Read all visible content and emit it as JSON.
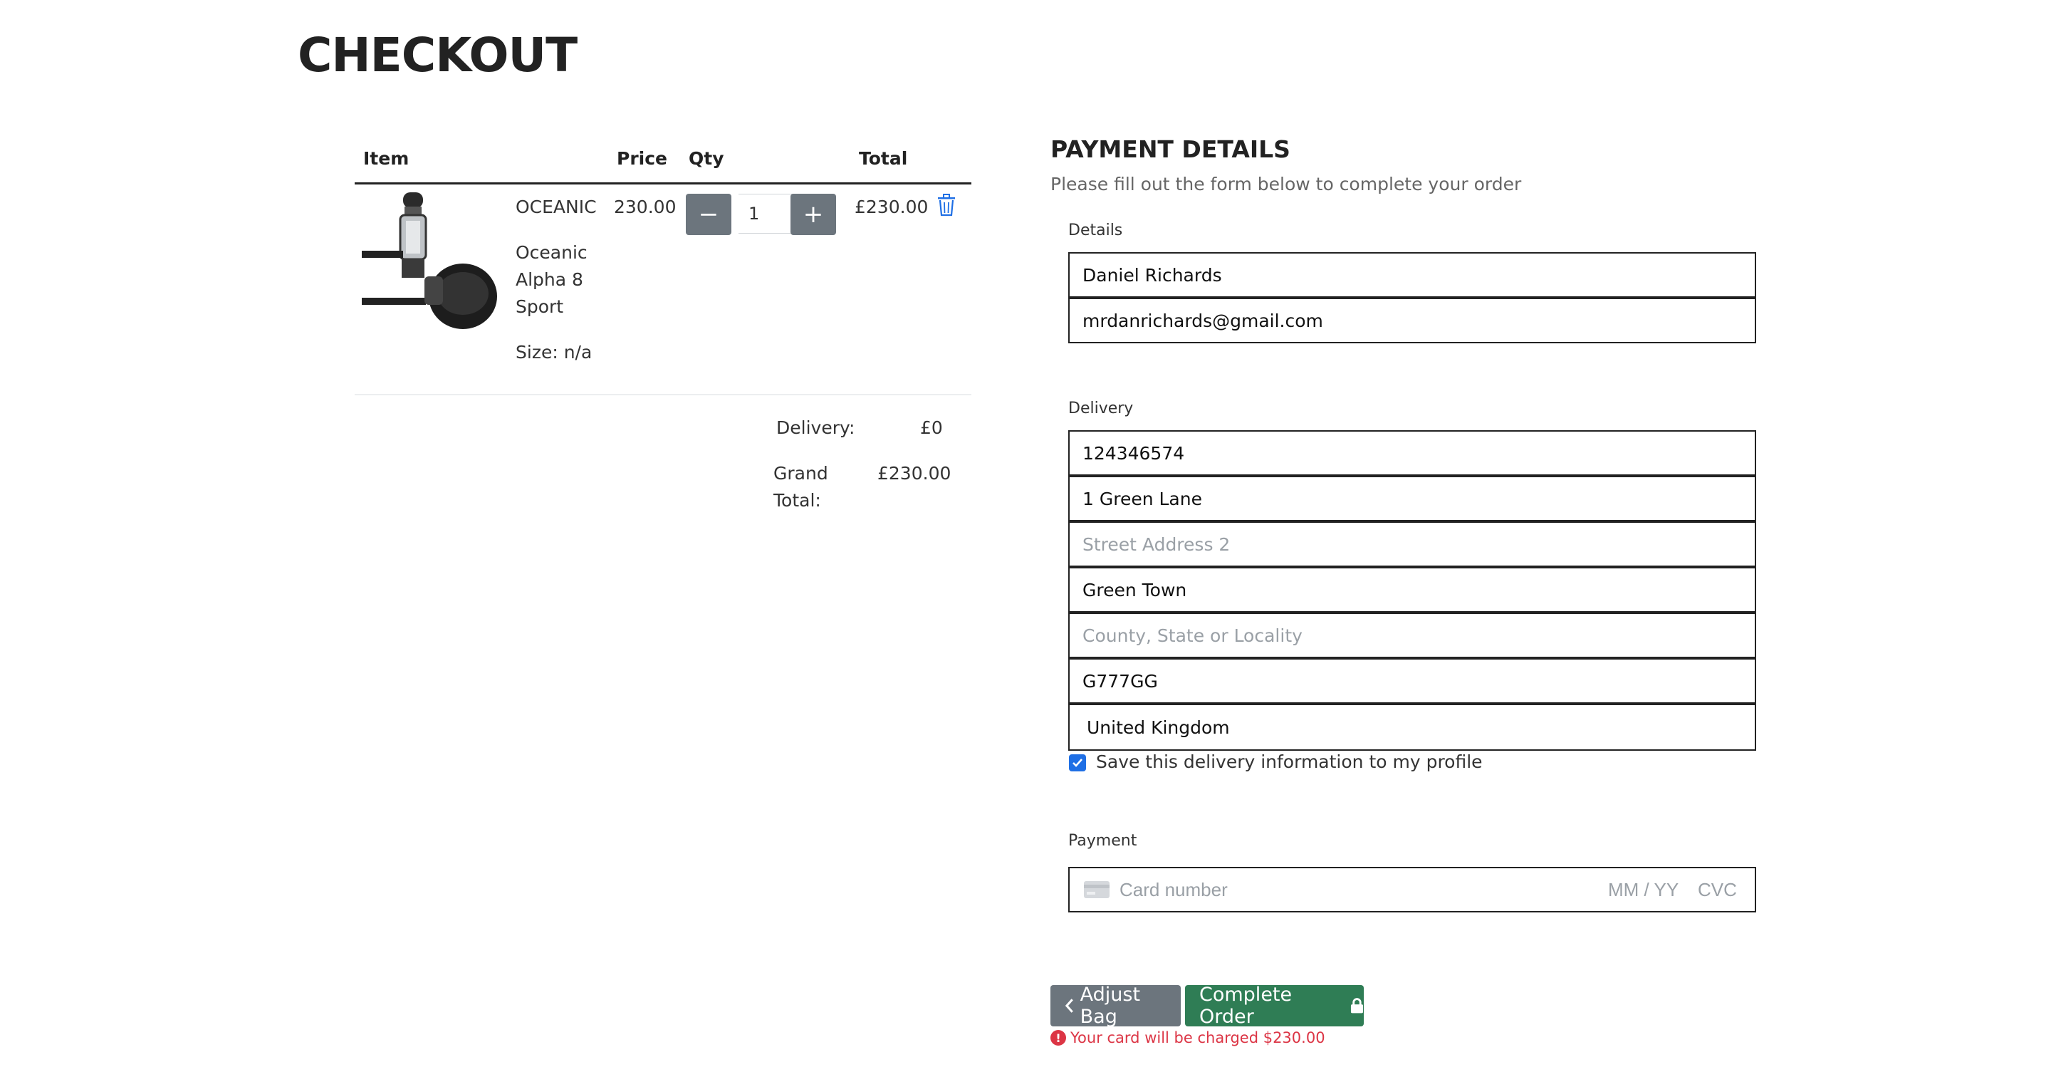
{
  "page": {
    "title": "CHECKOUT"
  },
  "bag": {
    "headers": {
      "item": "Item",
      "price": "Price",
      "qty": "Qty",
      "total": "Total"
    },
    "items": [
      {
        "brand": "OCEANIC",
        "name_lines": [
          "Oceanic",
          "Alpha 8",
          "Sport"
        ],
        "size": "Size: n/a",
        "price": "230.00",
        "qty": "1",
        "total": "£230.00",
        "image_icon": "regulator-product-image"
      }
    ],
    "delivery_label": "Delivery:",
    "delivery_value": "£0",
    "grand_total_label_1": "Grand",
    "grand_total_label_2": "Total:",
    "grand_total_value": "£230.00",
    "qty_minus_icon": "minus-icon",
    "qty_plus_icon": "plus-icon",
    "remove_icon": "trash-icon"
  },
  "payment": {
    "title": "PAYMENT DETAILS",
    "subtitle": "Please fill out the form below to complete your order",
    "details_label": "Details",
    "full_name": "Daniel Richards",
    "email": "mrdanrichards@gmail.com",
    "delivery_label": "Delivery",
    "phone": "124346574",
    "street1": "1 Green Lane",
    "street2_placeholder": "Street Address 2",
    "town": "Green Town",
    "county_placeholder": "County, State or Locality",
    "postcode": "G777GG",
    "country": "United Kingdom",
    "save_info_label": "Save this delivery information to my profile",
    "save_info_checked": true,
    "payment_label": "Payment",
    "card_placeholder": "Card number",
    "expiry_placeholder": "MM / YY",
    "cvc_placeholder": "CVC",
    "adjust_bag_label": "Adjust Bag",
    "complete_order_label": "Complete Order",
    "charge_note": "Your card will be charged $230.00"
  },
  "colors": {
    "adjust_button": "#6c757d",
    "complete_button": "#2f7d55",
    "checkbox": "#1f6fe5",
    "alert": "#dc3545"
  }
}
